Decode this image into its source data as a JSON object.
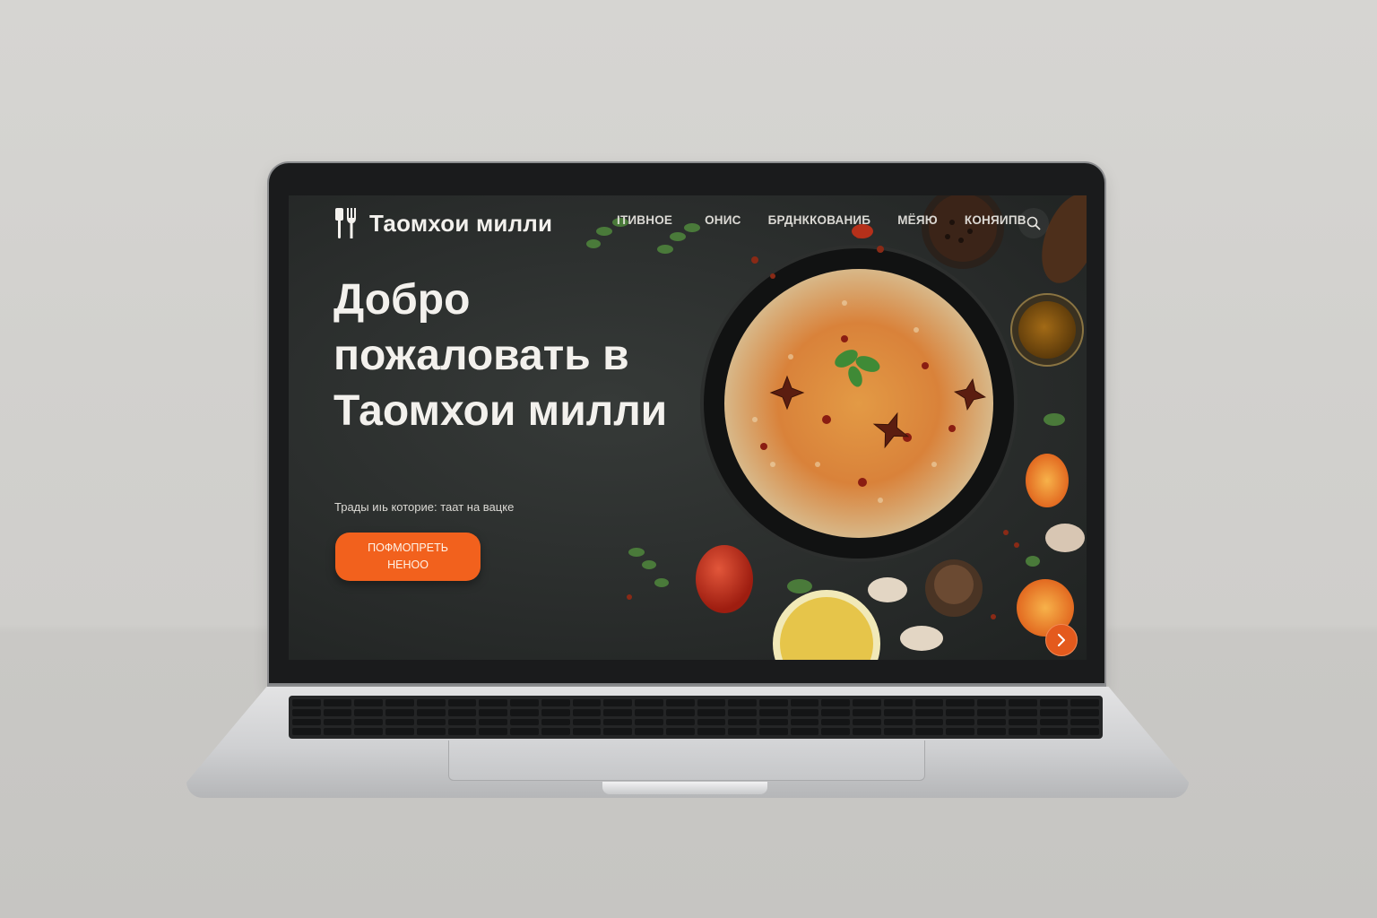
{
  "site": {
    "brand": "Таомхои милли",
    "nav": [
      "ІТИВНОЕ",
      "ОНИС",
      "БРДНККОВАНИБ",
      "МЁЯЮ",
      "КОНЯИПВ"
    ]
  },
  "hero": {
    "title": "Добро пожаловать в Таомхои милли",
    "subtitle": "Трады иıь которие: таат на вацке",
    "cta_label": "ПОФМОПРЕТЬ НЕНОО"
  },
  "colors": {
    "accent": "#f2611d",
    "background": "#2a2d2c",
    "text": "#f3f1ed"
  },
  "icons": [
    "utensils-icon",
    "search-icon",
    "chevron-right-icon"
  ]
}
